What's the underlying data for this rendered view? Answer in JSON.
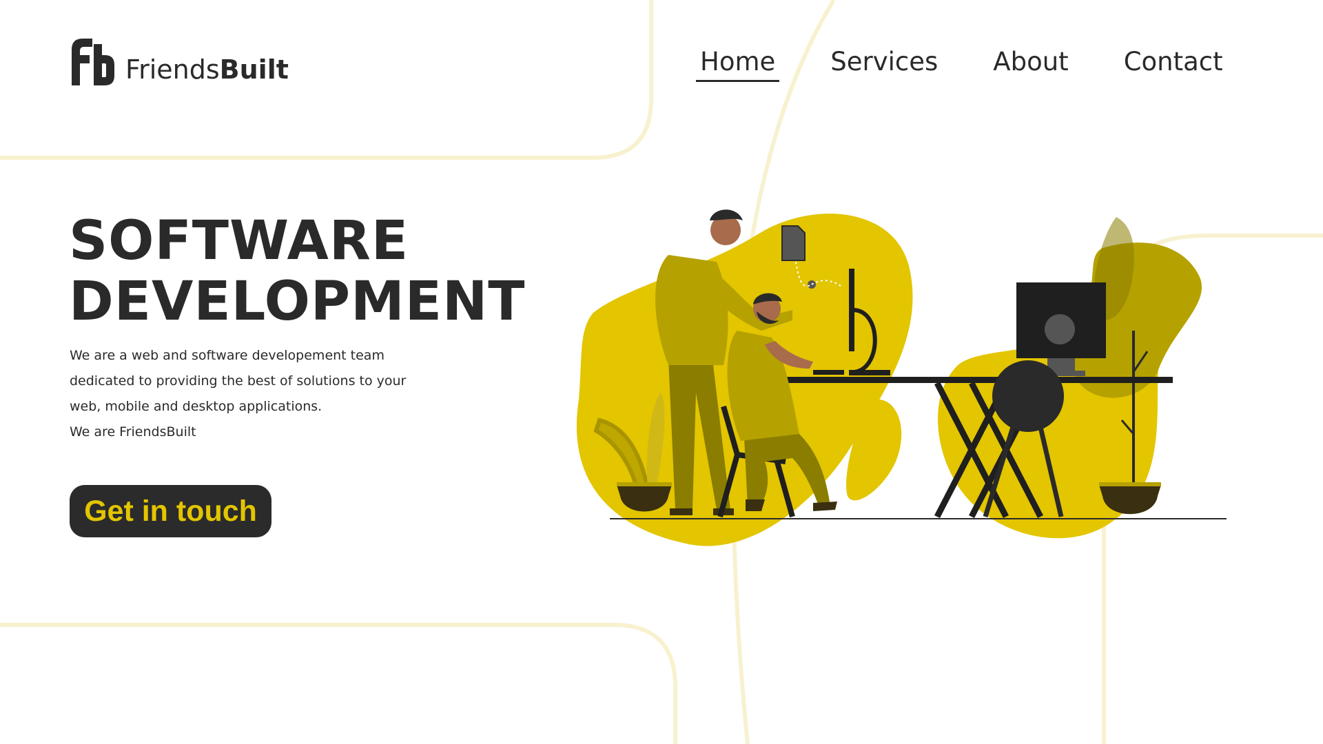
{
  "brand": {
    "name_light": "Friends",
    "name_bold": "Built"
  },
  "nav": {
    "items": [
      {
        "label": "Home",
        "active": true
      },
      {
        "label": "Services",
        "active": false
      },
      {
        "label": "About",
        "active": false
      },
      {
        "label": "Contact",
        "active": false
      }
    ]
  },
  "hero": {
    "title_line1": "SOFTWARE",
    "title_line2": "DEVELOPMENT",
    "desc_lines": [
      "We are a web and software developement team",
      "dedicated to providing the best of solutions to your",
      "web, mobile and desktop applications.",
      "We are FriendsBuilt"
    ],
    "cta_label": "Get in touch"
  },
  "colors": {
    "accent": "#e3c500",
    "accent_dark": "#b5a100",
    "olive": "#8a7d00",
    "dark": "#2a2a2a",
    "line": "#f8f1cf"
  }
}
